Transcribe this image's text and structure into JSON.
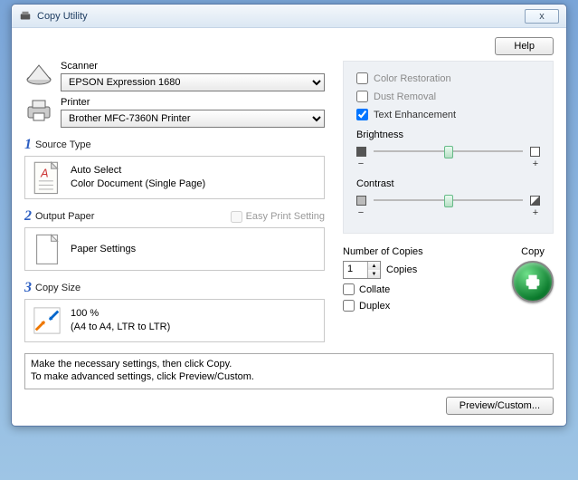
{
  "window": {
    "title": "Copy Utility"
  },
  "buttons": {
    "help": "Help",
    "preview": "Preview/Custom...",
    "close": "x"
  },
  "scanner": {
    "label": "Scanner",
    "value": "EPSON Expression 1680"
  },
  "printer": {
    "label": "Printer",
    "value": "Brother MFC-7360N Printer"
  },
  "sections": {
    "source": {
      "num": "1",
      "title": "Source Type",
      "line1": "Auto Select",
      "line2": "Color Document (Single Page)"
    },
    "output": {
      "num": "2",
      "title": "Output Paper",
      "line1": "Paper Settings",
      "easy": "Easy Print Setting"
    },
    "copy": {
      "num": "3",
      "title": "Copy Size",
      "line1": "100 %",
      "line2": "(A4 to A4, LTR to LTR)"
    }
  },
  "enhance": {
    "color_restoration": "Color Restoration",
    "dust_removal": "Dust Removal",
    "text_enhancement": "Text Enhancement",
    "brightness": "Brightness",
    "contrast": "Contrast"
  },
  "copies": {
    "label": "Number of Copies",
    "value": "1",
    "unit": "Copies",
    "collate": "Collate",
    "duplex": "Duplex",
    "copy_label": "Copy"
  },
  "message": {
    "line1": "Make the necessary settings, then click Copy.",
    "line2": "To make advanced settings, click Preview/Custom."
  }
}
